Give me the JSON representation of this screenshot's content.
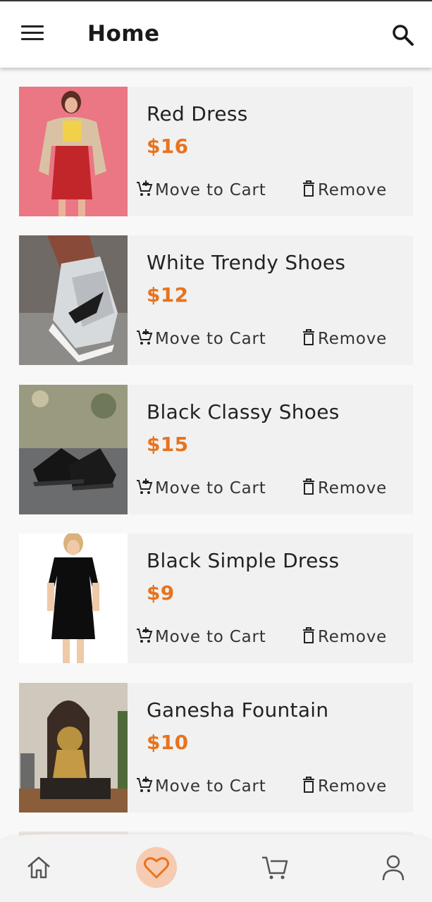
{
  "app_bar": {
    "title": "Home",
    "menu_icon": "hamburger-menu-icon",
    "search_icon": "search-icon"
  },
  "wishlist": {
    "move_label": "Move to Cart",
    "remove_label": "Remove",
    "items": [
      {
        "name": "Red Dress",
        "price": "$16",
        "image": "red-dress-photo"
      },
      {
        "name": "White Trendy Shoes",
        "price": "$12",
        "image": "white-shoes-photo"
      },
      {
        "name": "Black Classy Shoes",
        "price": "$15",
        "image": "black-shoes-photo"
      },
      {
        "name": "Black Simple Dress",
        "price": "$9",
        "image": "black-dress-photo"
      },
      {
        "name": "Ganesha Fountain",
        "price": "$10",
        "image": "ganesha-fountain-photo"
      }
    ]
  },
  "bottom_nav": {
    "items": [
      "home-icon",
      "heart-icon",
      "cart-icon",
      "profile-icon"
    ],
    "active": "heart-icon"
  },
  "colors": {
    "accent": "#e8731d",
    "active_nav_bg": "#f7cbb1",
    "card_bg": "#f1f1f1"
  }
}
